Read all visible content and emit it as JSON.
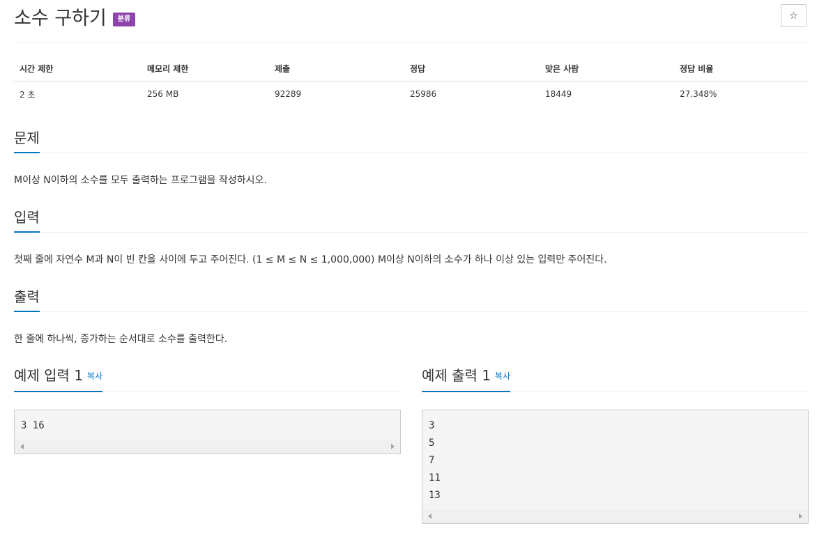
{
  "problem": {
    "title": "소수 구하기",
    "badge": "분류",
    "star_icon": "☆"
  },
  "info_table": {
    "headers": [
      "시간 제한",
      "메모리 제한",
      "제출",
      "정답",
      "맞은 사람",
      "정답 비율"
    ],
    "values": [
      "2 초",
      "256 MB",
      "92289",
      "25986",
      "18449",
      "27.348%"
    ]
  },
  "sections": [
    {
      "title": "문제",
      "text": "M이상 N이하의 소수를 모두 출력하는 프로그램을 작성하시오."
    },
    {
      "title": "입력",
      "text": "첫째 줄에 자연수 M과 N이 빈 칸을 사이에 두고 주어진다. (1 ≤ M ≤ N ≤ 1,000,000) M이상 N이하의 소수가 하나 이상 있는 입력만 주어진다."
    },
    {
      "title": "출력",
      "text": "한 줄에 하나씩, 증가하는 순서대로 소수를 출력한다."
    }
  ],
  "samples": {
    "input": {
      "title": "예제 입력 1",
      "copy_label": "복사",
      "content": "3 16"
    },
    "output": {
      "title": "예제 출력 1",
      "copy_label": "복사",
      "content": "3\n5\n7\n11\n13"
    }
  },
  "icons": {
    "star": "star-icon",
    "scroll_left": "scroll-left-arrow-icon",
    "scroll_right": "scroll-right-arrow-icon"
  },
  "colors": {
    "badge": "#8e44ad",
    "accent": "#0076c0"
  }
}
